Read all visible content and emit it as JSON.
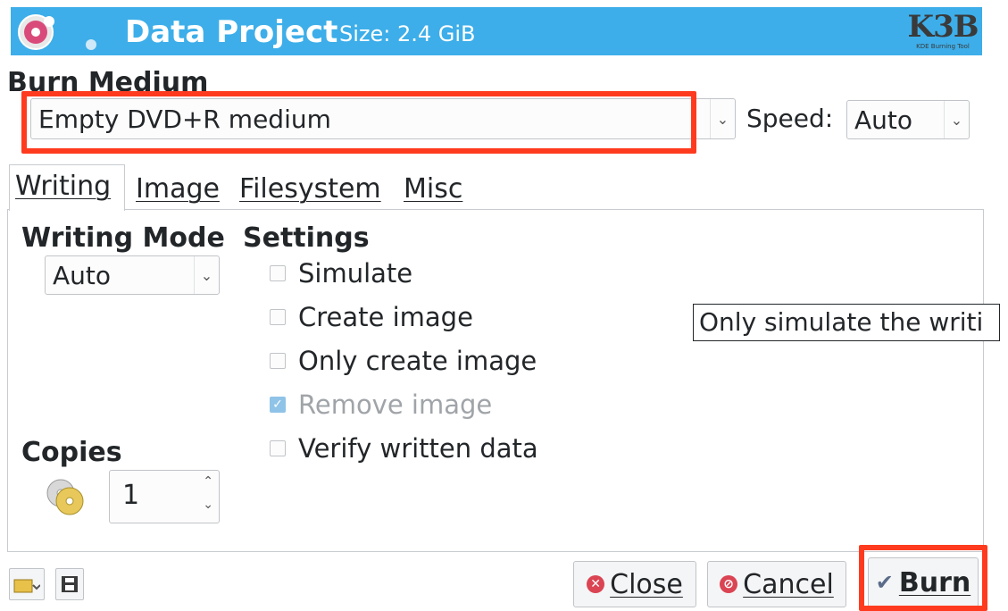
{
  "header": {
    "title": "Data Project",
    "size": "Size: 2.4 GiB",
    "logo_text": "K3B",
    "logo_subtext": "KDE Burning Tool"
  },
  "burn_medium": {
    "title": "Burn Medium",
    "medium_value": "Empty DVD+R medium",
    "speed_label": "Speed:",
    "speed_value": "Auto"
  },
  "tabs": [
    {
      "label": "Writing",
      "active": true
    },
    {
      "label": "Image",
      "active": false
    },
    {
      "label": "Filesystem",
      "active": false
    },
    {
      "label": "Misc",
      "active": false
    }
  ],
  "writing_mode": {
    "title": "Writing Mode",
    "value": "Auto"
  },
  "settings": {
    "title": "Settings",
    "options": [
      {
        "label": "Simulate",
        "checked": false,
        "enabled": true
      },
      {
        "label": "Create image",
        "checked": false,
        "enabled": true
      },
      {
        "label": "Only create image",
        "checked": false,
        "enabled": true
      },
      {
        "label": "Remove image",
        "checked": true,
        "enabled": false
      },
      {
        "label": "Verify written data",
        "checked": false,
        "enabled": true
      }
    ]
  },
  "tooltip": {
    "text": "Only simulate the writi"
  },
  "copies": {
    "title": "Copies",
    "value": "1"
  },
  "buttons": {
    "close": "Close",
    "cancel": "Cancel",
    "burn": "Burn"
  },
  "icons": {
    "app": "k3b-disc-icon",
    "copies": "discs-icon",
    "load": "load-settings-icon",
    "save": "save-icon"
  },
  "colors": {
    "banner": "#3daee9",
    "highlight": "#ff3b1f",
    "accent": "#8fc3e8"
  }
}
